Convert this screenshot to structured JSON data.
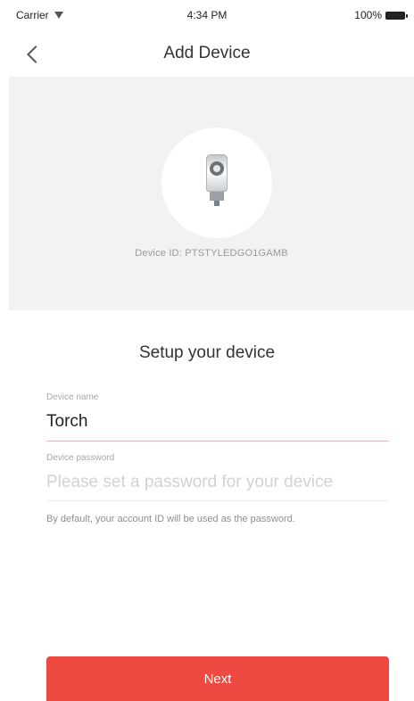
{
  "status_bar": {
    "carrier": "Carrier",
    "time": "4:34 PM",
    "battery": "100%"
  },
  "nav": {
    "title": "Add Device",
    "back_icon": "chevron-left-icon"
  },
  "device": {
    "id_text": "Device ID: PTSTYLEDGO1GAMB",
    "image_icon": "radiator-valve-device-icon"
  },
  "setup": {
    "title": "Setup your device",
    "name_label": "Device name",
    "name_value": "Torch",
    "password_label": "Device password",
    "password_placeholder": "Please set a password for your device",
    "hint": "By default, your account ID will be used as the password."
  },
  "actions": {
    "next_label": "Next"
  },
  "colors": {
    "accent": "#ee4a42",
    "panel_background": "#f1f2f4"
  }
}
